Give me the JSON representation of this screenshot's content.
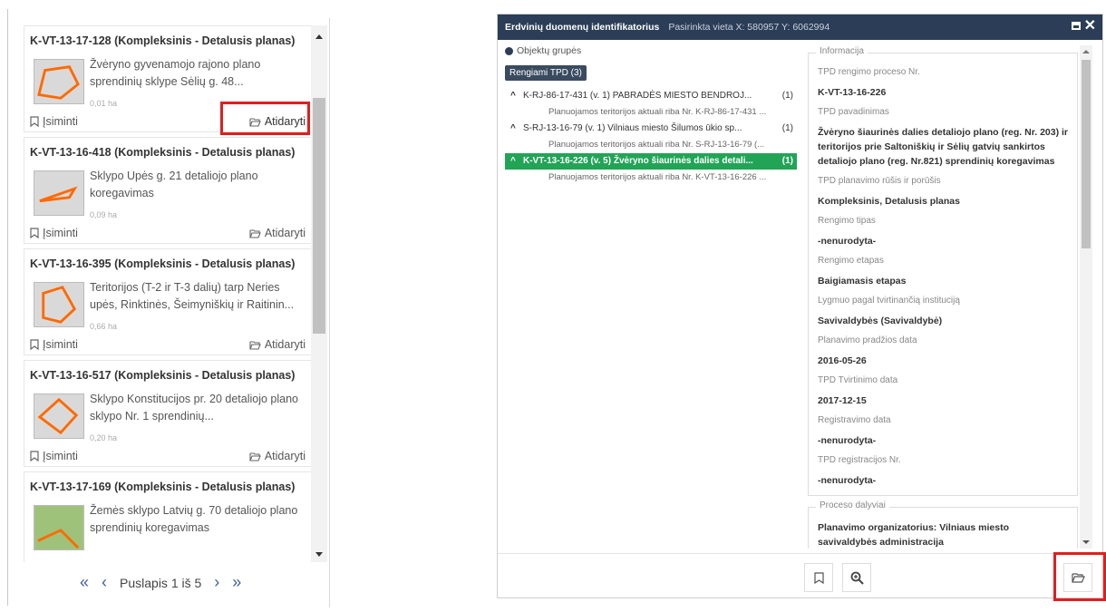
{
  "list": {
    "remember_label": "Įsiminti",
    "open_label": "Atidaryti",
    "items": [
      {
        "title": "K-VT-13-17-128 (Kompleksinis - Detalusis planas)",
        "desc": "Žvėryno gyvenamojo rajono plano sprendinių sklype Sėlių g. 48...",
        "area": "0,01 ha"
      },
      {
        "title": "K-VT-13-16-418 (Kompleksinis - Detalusis planas)",
        "desc": "Sklypo Upės g. 21 detaliojo plano koregavimas",
        "area": "0,09 ha"
      },
      {
        "title": "K-VT-13-16-395 (Kompleksinis - Detalusis planas)",
        "desc": "Teritorijos (T-2 ir T-3 dalių) tarp Neries upės, Rinktinės, Šeimyniškių ir Raitinin...",
        "area": "0,66 ha"
      },
      {
        "title": "K-VT-13-16-517 (Kompleksinis - Detalusis planas)",
        "desc": "Sklypo Konstitucijos pr. 20 detaliojo plano sklypo Nr. 1 sprendinių...",
        "area": "0,20 ha"
      },
      {
        "title": "K-VT-13-17-169 (Kompleksinis - Detalusis planas)",
        "desc": "Žemės sklypo Latvių g. 70 detaliojo plano sprendinių koregavimas",
        "area": ""
      }
    ]
  },
  "pager": {
    "first": "«",
    "prev": "‹",
    "label": "Puslapis 1 iš 5",
    "next": "›",
    "last": "»"
  },
  "ident": {
    "title": "Erdvinių duomenų identifikatorius",
    "coords": "Pasirinkta vieta X: 580957 Y: 6062994",
    "group_label": "Objektų grupės",
    "tpd_badge": "Rengiami TPD (3)",
    "tree": [
      {
        "label": "K-RJ-86-17-431 (v. 1) PABRADĖS MIESTO BENDROJ...",
        "count": "(1)",
        "sub": "Planuojamos teritorijos aktuali riba Nr. K-RJ-86-17-431 ..."
      },
      {
        "label": "S-RJ-13-16-79 (v. 1) Vilniaus miesto Šilumos ūkio sp...",
        "count": "(1)",
        "sub": "Planuojamos teritorijos aktuali riba Nr. S-RJ-13-16-79 (..."
      },
      {
        "label": "K-VT-13-16-226 (v. 5) Žvėryno šiaurinės dalies detali...",
        "count": "(1)",
        "sub": "Planuojamos teritorijos aktuali riba Nr. K-VT-13-16-226 ..."
      }
    ],
    "info_legend": "Informacija",
    "info": [
      {
        "label": "TPD rengimo proceso Nr.",
        "value": "K-VT-13-16-226"
      },
      {
        "label": "TPD pavadinimas",
        "value": "Žvėryno šiaurinės dalies detaliojo plano (reg. Nr. 203) ir teritorijos prie Saltoniškių ir Sėlių gatvių sankirtos detaliojo plano (reg. Nr.821) sprendinių koregavimas"
      },
      {
        "label": "TPD planavimo rūšis ir porūšis",
        "value": "Kompleksinis, Detalusis planas"
      },
      {
        "label": "Rengimo tipas",
        "value": "-nenurodyta-"
      },
      {
        "label": "Rengimo etapas",
        "value": "Baigiamasis etapas"
      },
      {
        "label": "Lygmuo pagal tvirtinančią instituciją",
        "value": "Savivaldybės (Savivaldybė)"
      },
      {
        "label": "Planavimo pradžios data",
        "value": "2016-05-26"
      },
      {
        "label": "TPD Tvirtinimo data",
        "value": "2017-12-15"
      },
      {
        "label": "Registravimo data",
        "value": "-nenurodyta-"
      },
      {
        "label": "TPD registracijos Nr.",
        "value": "-nenurodyta-"
      }
    ],
    "process_legend": "Proceso dalyviai",
    "process_value": "Planavimo organizatorius: Vilniaus miesto savivaldybės administracija"
  },
  "colors": {
    "header_bg": "#2c3e57",
    "selected_green": "#22a457",
    "highlight_red": "#e01e1e",
    "plot_outline": "#ff6a00"
  }
}
